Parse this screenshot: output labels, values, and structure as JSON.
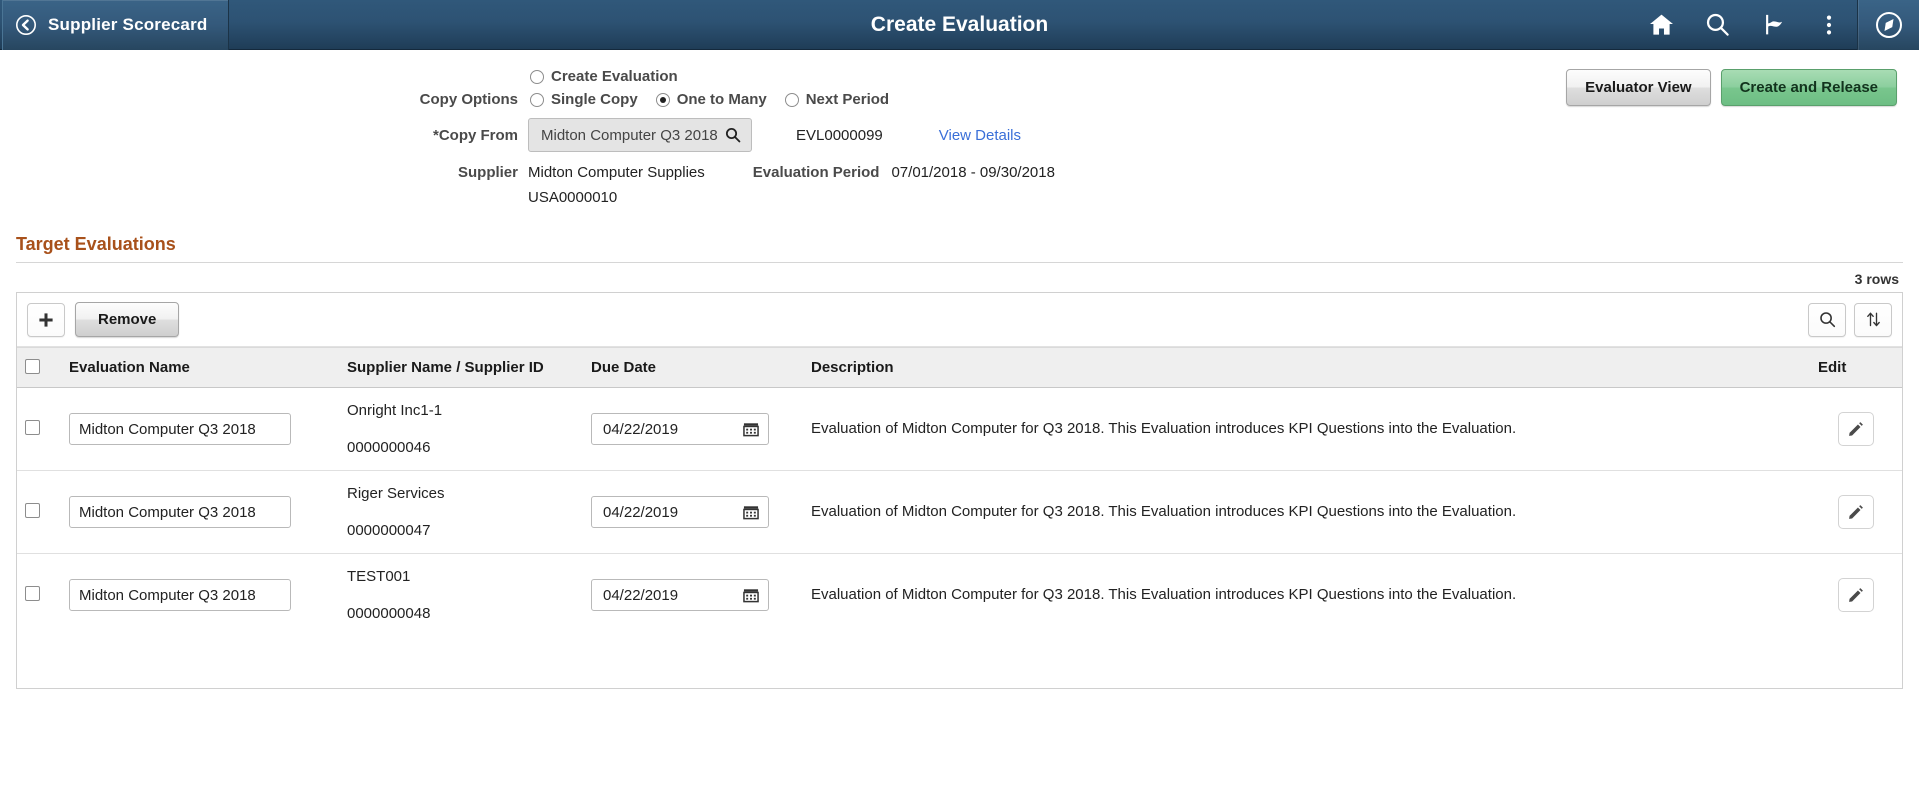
{
  "header": {
    "back_label": "Supplier Scorecard",
    "title": "Create Evaluation",
    "icons": [
      "home-icon",
      "search-icon",
      "notification-flag-icon",
      "actions-menu-icon",
      "navbar-compass-icon"
    ]
  },
  "top_actions": {
    "evaluator_view_label": "Evaluator View",
    "create_and_release_label": "Create and Release"
  },
  "form": {
    "create_evaluation_label": "Create Evaluation",
    "create_evaluation_selected": false,
    "copy_options_label": "Copy Options",
    "copy_options": [
      {
        "label": "Single Copy",
        "selected": false
      },
      {
        "label": "One to Many",
        "selected": true
      },
      {
        "label": "Next Period",
        "selected": false
      }
    ],
    "copy_from_label": "*Copy From",
    "copy_from_value": "Midton Computer Q3 2018",
    "copy_from_prompt_icon": "search-icon",
    "evaluation_id": "EVL0000099",
    "view_details_label": "View Details",
    "supplier_label": "Supplier",
    "supplier_name": "Midton Computer Supplies",
    "supplier_id": "USA0000010",
    "evaluation_period_label": "Evaluation Period",
    "evaluation_period_value": "07/01/2018  - 09/30/2018"
  },
  "target_evaluations": {
    "section_title": "Target Evaluations",
    "rows_count_label": "3 rows",
    "toolbar": {
      "add_label": "+",
      "remove_label": "Remove",
      "find_icon": "search-icon",
      "sort_icon": "sort-updown-icon"
    },
    "columns": [
      "Evaluation Name",
      "Supplier Name / Supplier ID",
      "Due Date",
      "Description",
      "Edit"
    ],
    "rows": [
      {
        "selected": false,
        "evaluation_name": "Midton Computer Q3 2018",
        "supplier_name": "Onright Inc1-1",
        "supplier_id": "0000000046",
        "due_date": "04/22/2019",
        "description": "Evaluation of Midton Computer for Q3 2018.  This Evaluation introduces KPI Questions into the Evaluation."
      },
      {
        "selected": false,
        "evaluation_name": "Midton Computer Q3 2018",
        "supplier_name": "Riger Services",
        "supplier_id": "0000000047",
        "due_date": "04/22/2019",
        "description": "Evaluation of Midton Computer for Q3 2018.  This Evaluation introduces KPI Questions into the Evaluation."
      },
      {
        "selected": false,
        "evaluation_name": "Midton Computer Q3 2018",
        "supplier_name": "TEST001",
        "supplier_id": "0000000048",
        "due_date": "04/22/2019",
        "description": "Evaluation of Midton Computer for Q3 2018.  This Evaluation introduces KPI Questions into the Evaluation."
      }
    ]
  },
  "colors": {
    "header_blue": "#2d5273",
    "accent_brown": "#a8511b",
    "link_blue": "#3a6fd8",
    "primary_green": "#8ccf9e"
  }
}
